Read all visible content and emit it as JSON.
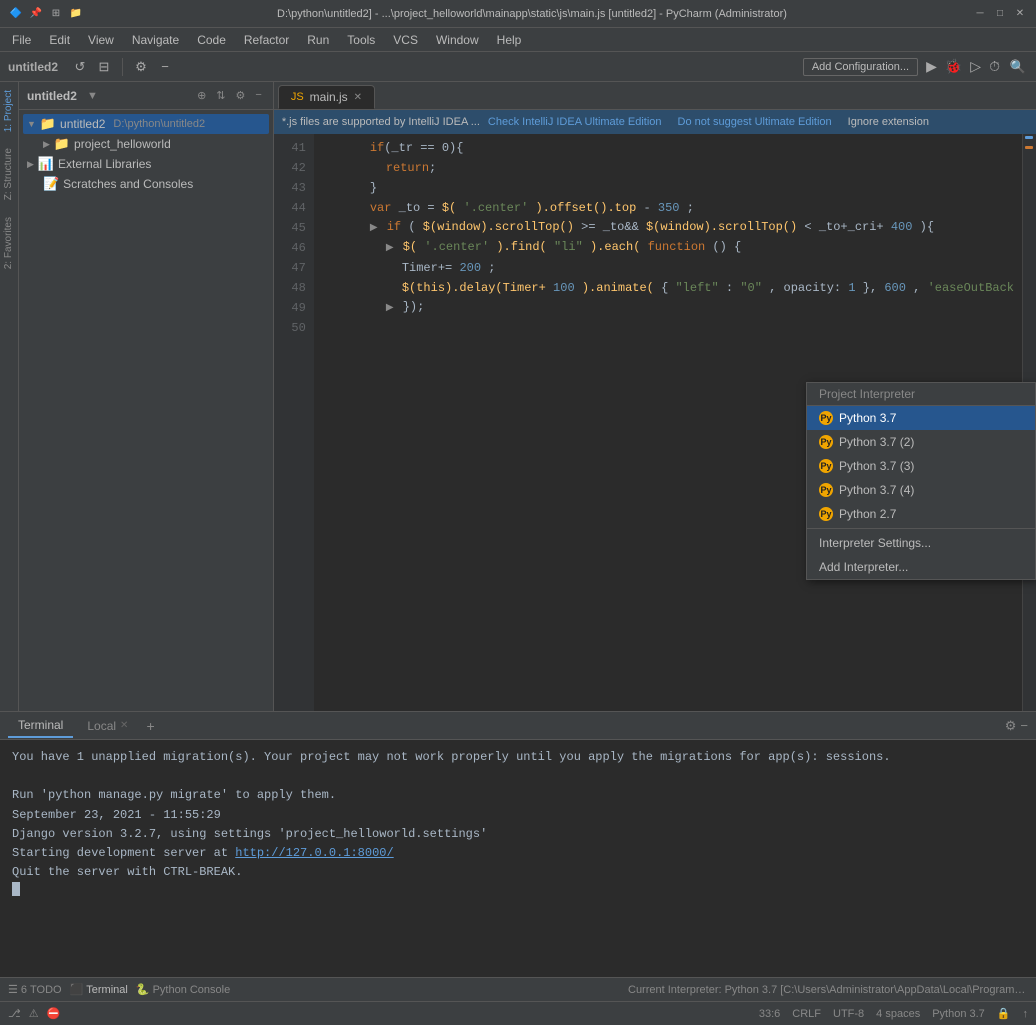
{
  "titleBar": {
    "path": "D:\\python\\untitled2] - ...\\project_helloworld\\mainapp\\static\\js\\main.js [untitled2] - PyCharm (Administrator)",
    "icons": [
      "app-icon",
      "minimize-icon",
      "maximize-icon",
      "close-icon"
    ]
  },
  "menuBar": {
    "items": [
      "File",
      "Edit",
      "View",
      "Navigate",
      "Code",
      "Refactor",
      "Run",
      "Tools",
      "VCS",
      "Window",
      "Help"
    ]
  },
  "toolbar": {
    "projectLabel": "untitled2",
    "addConfigLabel": "Add Configuration...",
    "icons": [
      "run-icon",
      "debug-icon",
      "coverage-icon",
      "profile-icon"
    ]
  },
  "notificationBar": {
    "text": "*.js files are supported by IntelliJ IDEA ...",
    "checkLink": "Check IntelliJ IDEA Ultimate Edition",
    "doNotSuggest": "Do not suggest Ultimate Edition",
    "ignore": "Ignore extension"
  },
  "projectPanel": {
    "title": "Project",
    "rootLabel": "untitled2",
    "rootPath": "D:\\python\\untitled2",
    "items": [
      {
        "label": "project_helloworld",
        "indent": 1,
        "type": "folder"
      },
      {
        "label": "External Libraries",
        "indent": 0,
        "type": "lib"
      },
      {
        "label": "Scratches and Consoles",
        "indent": 0,
        "type": "scratches"
      }
    ]
  },
  "editor": {
    "tab": {
      "label": "main.js",
      "icon": "js-file-icon"
    },
    "lines": [
      {
        "num": 41,
        "content": "if(_tr == 0){",
        "indent": 3
      },
      {
        "num": 42,
        "content": "return;",
        "indent": 4
      },
      {
        "num": 43,
        "content": "}",
        "indent": 3
      },
      {
        "num": 44,
        "content": "var _to = $('.center').offset().top-350;",
        "indent": 3
      },
      {
        "num": 45,
        "content": "if(  $(window).scrollTop() >= _to&&$(window).scrollTop() < _to+_cri+400){",
        "indent": 3,
        "folded": true
      },
      {
        "num": 46,
        "content": "$('.center').find(\"li\").each(function() {",
        "indent": 4,
        "folded": true
      },
      {
        "num": 47,
        "content": "Timer+=200;",
        "indent": 5
      },
      {
        "num": 48,
        "content": "$(this).delay(Timer+100).animate({\"left\":\"0\", opacity: 1}, 600,'easeOutBack",
        "indent": 5
      },
      {
        "num": 49,
        "content": "});",
        "indent": 4,
        "folded": true
      },
      {
        "num": 50,
        "content": "",
        "indent": 3
      }
    ]
  },
  "terminal": {
    "tabs": [
      "Terminal",
      "Local",
      "Python Console"
    ],
    "content": [
      "You have 1 unapplied migration(s). Your project may not work properly until you apply the migrations for app(s): sessions.",
      "",
      "Run 'python manage.py migrate' to apply them.",
      "September 23, 2021 - 11:55:29",
      "Django version 3.2.7, using settings 'project_helloworld.settings'",
      "Starting development server at http://127.0.0.1:8000/",
      "Quit the server with CTRL-BREAK."
    ],
    "serverUrl": "http://127.0.0.1:8000/"
  },
  "statusBar": {
    "position": "33:6",
    "lineEnding": "CRLF",
    "encoding": "UTF-8",
    "indent": "4 spaces",
    "interpreter": "Python 3.7",
    "currentInterpreter": "Current Interpreter: Python 3.7 [C:\\Users\\Administrator\\AppData\\Local\\Programs\\Python\\Pyth...",
    "bottomTabs": [
      {
        "num": "6",
        "label": "TODO"
      },
      {
        "label": "Terminal"
      },
      {
        "label": "Python Console"
      }
    ]
  },
  "interpreterPopup": {
    "header": "Project Interpreter",
    "items": [
      {
        "label": "Python 3.7",
        "selected": true
      },
      {
        "label": "Python 3.7 (2)",
        "selected": false
      },
      {
        "label": "Python 3.7 (3)",
        "selected": false
      },
      {
        "label": "Python 3.7 (4)",
        "selected": false
      },
      {
        "label": "Python 2.7",
        "selected": false
      }
    ],
    "actions": [
      {
        "label": "Interpreter Settings..."
      },
      {
        "label": "Add Interpreter..."
      }
    ]
  }
}
